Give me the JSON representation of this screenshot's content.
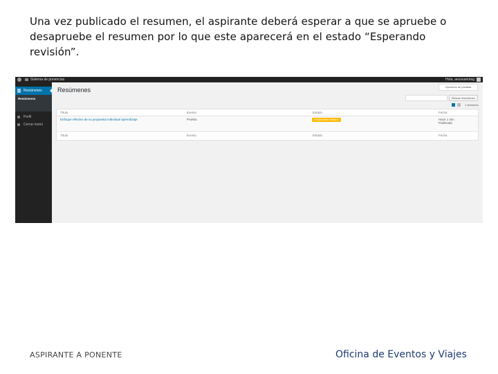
{
  "slide": {
    "caption": "Una vez publicado el resumen, el aspirante deberá esperar a que se apruebe o desapruebe el resumen por lo que este aparecerá en el estado “Esperando revisión”.",
    "footer_left": "ASPIRANTE A PONENTE",
    "footer_right": "Oficina de Eventos y Viajes"
  },
  "screenshot": {
    "admin_bar": {
      "site_name": "Sistema de ponencias",
      "howdy": "Hola, aeusuariotag"
    },
    "sidebar": {
      "items": [
        {
          "label": "Resúmenes",
          "icon": "document-icon"
        },
        {
          "label": "Perfil",
          "icon": "user-icon"
        },
        {
          "label": "Cerrar menú",
          "icon": "collapse-icon"
        }
      ],
      "submenu_label": "Resúmenes"
    },
    "screen_options_label": "Opciones de pantalla",
    "page_title": "Resúmenes",
    "search": {
      "button_label": "Buscar resúmenes"
    },
    "items_count": "1 elemento",
    "table": {
      "headers": [
        "Título",
        "Evento",
        "Estado",
        "Fecha"
      ],
      "row": {
        "title": "Enfoque efectivo de su propuesta individual aprendizaje",
        "event": "Prueba",
        "status": "Esperando revisión",
        "date_line1": "Hace 1 min",
        "date_line2": "Publicada"
      },
      "footers": [
        "Título",
        "Evento",
        "Estado",
        "Fecha"
      ]
    },
    "colors": {
      "admin_bar": "#222222",
      "sidebar": "#222222",
      "active_menu": "#0073aa",
      "pending_badge": "#ffba00",
      "link": "#0073aa",
      "footer_brand": "#1f3a73"
    }
  }
}
